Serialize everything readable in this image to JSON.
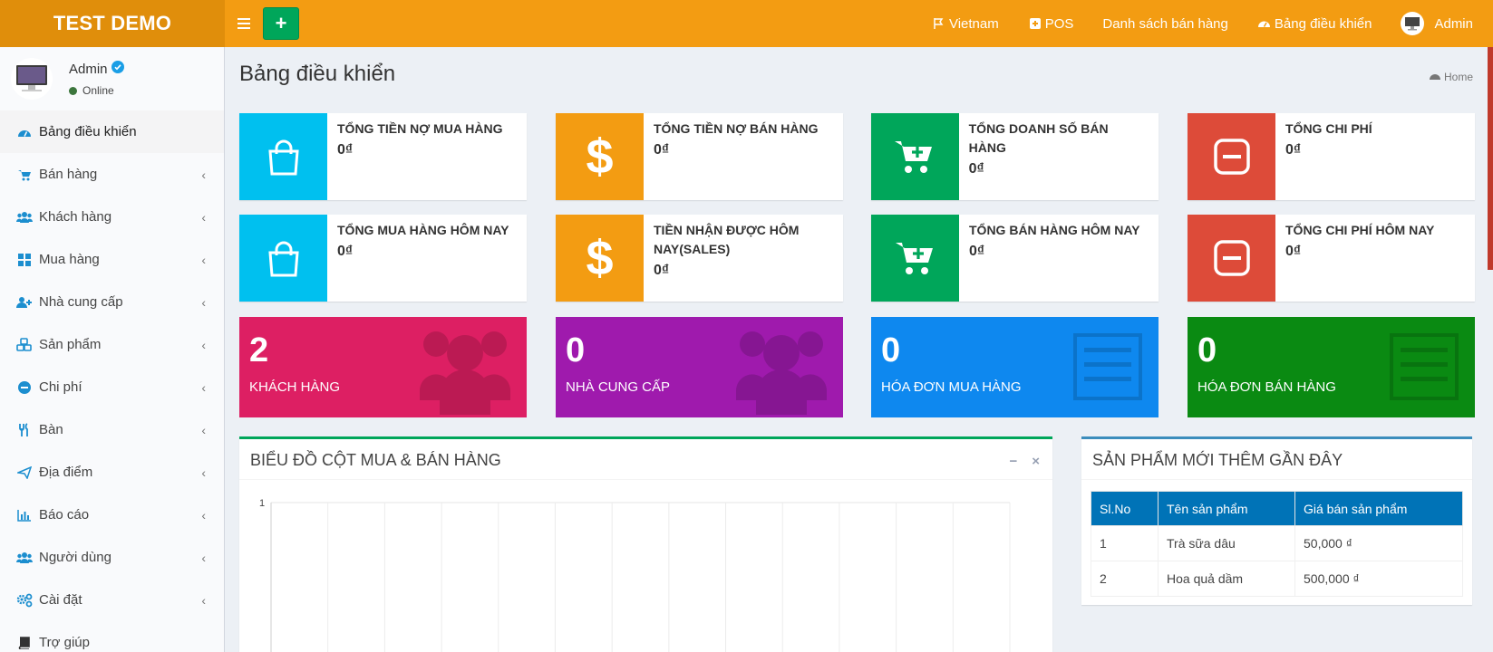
{
  "header": {
    "logo": "TEST DEMO",
    "nav": [
      {
        "label": "Vietnam",
        "icon": "flag-icon"
      },
      {
        "label": "POS",
        "icon": "plus-square-icon"
      },
      {
        "label": "Danh sách bán hàng",
        "icon": ""
      },
      {
        "label": "Bảng điều khiển",
        "icon": "dashboard-icon"
      },
      {
        "label": "Admin",
        "icon": "avatar"
      }
    ]
  },
  "sidebar": {
    "user": {
      "name": "Admin",
      "status": "Online"
    },
    "items": [
      {
        "label": "Bảng điều khiển",
        "icon": "dashboard-icon"
      },
      {
        "label": "Bán hàng",
        "icon": "cart-icon"
      },
      {
        "label": "Khách hàng",
        "icon": "users-icon"
      },
      {
        "label": "Mua hàng",
        "icon": "grid-icon"
      },
      {
        "label": "Nhà cung cấp",
        "icon": "user-plus-icon"
      },
      {
        "label": "Sản phẩm",
        "icon": "cubes-icon"
      },
      {
        "label": "Chi phí",
        "icon": "minus-circle-icon"
      },
      {
        "label": "Bàn",
        "icon": "cutlery-icon"
      },
      {
        "label": "Địa điểm",
        "icon": "send-icon"
      },
      {
        "label": "Báo cáo",
        "icon": "bar-chart-icon"
      },
      {
        "label": "Người dùng",
        "icon": "users-icon"
      },
      {
        "label": "Cài đặt",
        "icon": "cogs-icon"
      },
      {
        "label": "Trợ giúp",
        "icon": "book-icon"
      }
    ]
  },
  "page": {
    "title": "Bảng điều khiển",
    "breadcrumb": "Home"
  },
  "info_boxes": [
    {
      "text": "TỔNG TIỀN NỢ MUA HÀNG",
      "value": "0₫",
      "color": "#00c0ef",
      "icon": "shopping-bag-icon"
    },
    {
      "text": "TỔNG TIỀN NỢ BÁN HÀNG",
      "value": "0₫",
      "color": "#f39c12",
      "icon": "dollar-icon"
    },
    {
      "text": "TỔNG DOANH SỐ BÁN HÀNG",
      "value": "0₫",
      "color": "#00a65a",
      "icon": "cart-plus-icon"
    },
    {
      "text": "TỔNG CHI PHÍ",
      "value": "0₫",
      "color": "#dd4b39",
      "icon": "minus-square-icon"
    },
    {
      "text": "TỔNG MUA HÀNG HÔM NAY",
      "value": "0₫",
      "color": "#00c0ef",
      "icon": "shopping-bag-icon"
    },
    {
      "text": "TIỀN NHẬN ĐƯỢC HÔM NAY(SALES)",
      "value": "0₫",
      "color": "#f39c12",
      "icon": "dollar-icon"
    },
    {
      "text": "TỔNG BÁN HÀNG HÔM NAY",
      "value": "0₫",
      "color": "#00a65a",
      "icon": "cart-plus-icon"
    },
    {
      "text": "TỔNG CHI PHÍ HÔM NAY",
      "value": "0₫",
      "color": "#dd4b39",
      "icon": "minus-square-icon"
    }
  ],
  "small_boxes": [
    {
      "value": "2",
      "label": "KHÁCH HÀNG",
      "color": "#dd1f63",
      "icon": "users-icon"
    },
    {
      "value": "0",
      "label": "NHÀ CUNG CẤP",
      "color": "#9f1aad",
      "icon": "users-icon"
    },
    {
      "value": "0",
      "label": "HÓA ĐƠN MUA HÀNG",
      "color": "#0e88ef",
      "icon": "list-alt-icon"
    },
    {
      "value": "0",
      "label": "HÓA ĐƠN BÁN HÀNG",
      "color": "#0a8a12",
      "icon": "list-alt-icon"
    }
  ],
  "chart_box": {
    "title": "BIỂU ĐỒ CỘT MUA & BÁN HÀNG",
    "chart_data": {
      "type": "bar",
      "ytick_top": "1",
      "grid": true
    }
  },
  "products_box": {
    "title": "SẢN PHẨM MỚI THÊM GẦN ĐÂY",
    "columns": [
      "Sl.No",
      "Tên sản phẩm",
      "Giá bán sản phẩm"
    ],
    "rows": [
      [
        "1",
        "Trà sữa dâu",
        "50,000 ₫"
      ],
      [
        "2",
        "Hoa quả dầm",
        "500,000 ₫"
      ]
    ]
  }
}
